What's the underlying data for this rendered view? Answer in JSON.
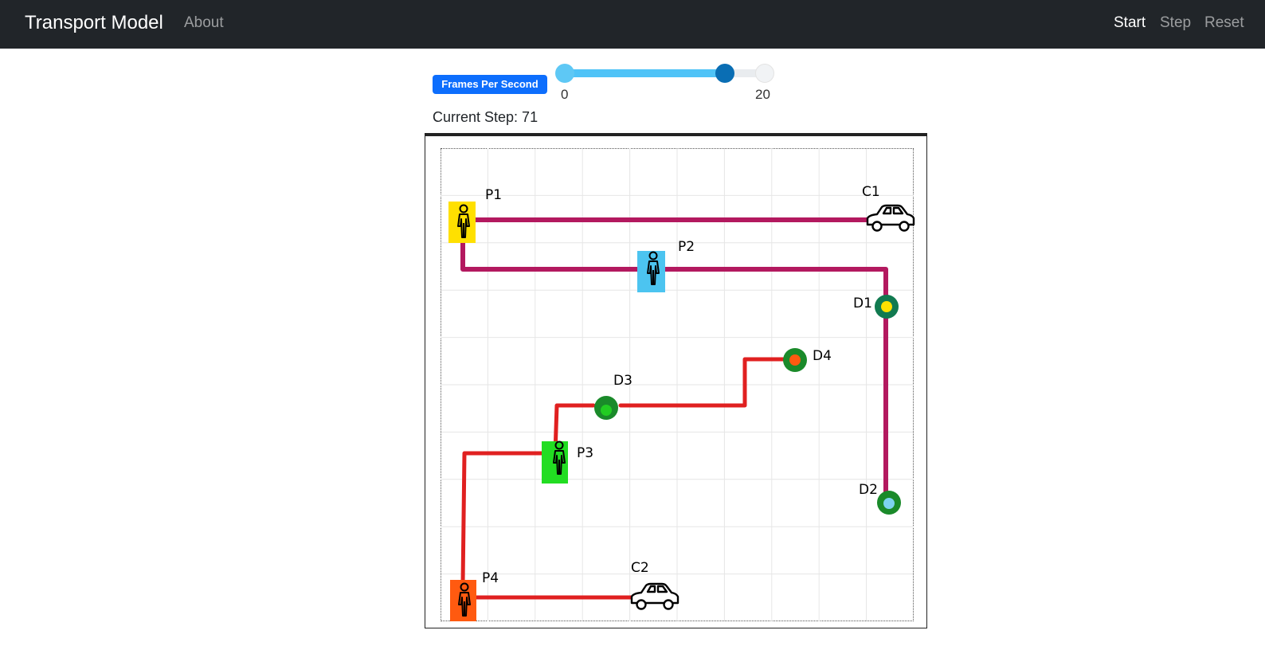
{
  "navbar": {
    "brand": "Transport Model",
    "about": "About",
    "start": "Start",
    "step": "Step",
    "reset": "Reset"
  },
  "controls": {
    "fps_label": "Frames Per Second",
    "slider": {
      "min": 0,
      "max": 20,
      "value": 16,
      "min_label": "0",
      "max_label": "20"
    },
    "current_step_label": "Current Step: 71"
  },
  "grid": {
    "size": 10,
    "passengers": [
      {
        "label": "P1",
        "color": "#ffe000"
      },
      {
        "label": "P2",
        "color": "#4cc4f0"
      },
      {
        "label": "P3",
        "color": "#22dd22"
      },
      {
        "label": "P4",
        "color": "#ff5a10"
      }
    ],
    "destinations": [
      {
        "label": "D1",
        "ring": "#117a50",
        "dot": "#ffe000"
      },
      {
        "label": "D2",
        "ring": "#1a8a2a",
        "dot": "#7dd3f0"
      },
      {
        "label": "D3",
        "ring": "#1a8a2a",
        "dot": "#22cc22"
      },
      {
        "label": "D4",
        "ring": "#1a8a2a",
        "dot": "#ff5a10"
      }
    ],
    "cars": [
      {
        "label": "C1"
      },
      {
        "label": "C2"
      }
    ],
    "route_colors": {
      "car1": "#b3195f",
      "car2": "#e02020"
    }
  }
}
